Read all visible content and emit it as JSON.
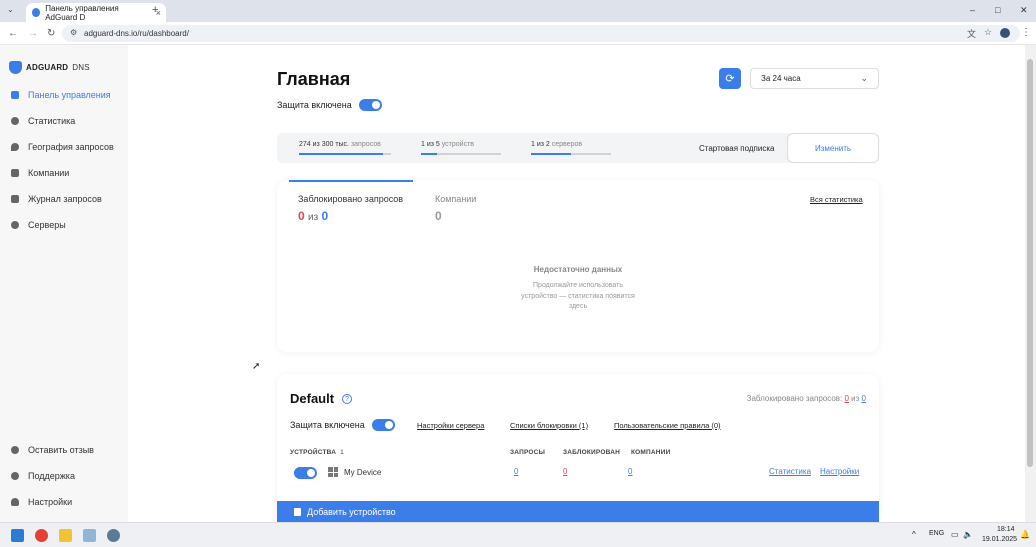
{
  "browser": {
    "tab_title": "Панель управления AdGuard D",
    "tab_close": "×",
    "new_tab": "+",
    "url": "adguard-dns.io/ru/dashboard/",
    "back": "←",
    "forward": "→",
    "reload": "↻",
    "minimize": "–",
    "maximize": "□",
    "close": "✕"
  },
  "sidebar": {
    "logo_brand": "ADGUARD",
    "logo_suffix": "DNS",
    "items": [
      {
        "label": "Панель управления",
        "icon": "home-icon",
        "active": true
      },
      {
        "label": "Статистика",
        "icon": "chart-icon"
      },
      {
        "label": "География запросов",
        "icon": "location-icon"
      },
      {
        "label": "Компании",
        "icon": "company-icon"
      },
      {
        "label": "Журнал запросов",
        "icon": "folder-icon"
      },
      {
        "label": "Серверы",
        "icon": "server-icon"
      }
    ],
    "bottom_items": [
      {
        "label": "Оставить отзыв",
        "icon": "chat-icon"
      },
      {
        "label": "Поддержка",
        "icon": "support-icon"
      },
      {
        "label": "Настройки",
        "icon": "user-icon"
      }
    ]
  },
  "header": {
    "title": "Главная",
    "protection_label": "Защита включена",
    "period": "За 24 часа"
  },
  "limits": {
    "requests_value": "274 из 300 тыс.",
    "requests_unit": "запросов",
    "requests_fill": 0.91,
    "devices_value": "1 из 5",
    "devices_unit": "устройств",
    "devices_fill": 0.2,
    "servers_value": "1 из 2",
    "servers_unit": "серверов",
    "servers_fill": 0.5,
    "plan": "Стартовая подписка",
    "change": "Изменить"
  },
  "stats_card": {
    "tab_blocked": "Заблокировано запросов",
    "blocked_num": "0",
    "of": "из",
    "total_num": "0",
    "tab_companies": "Компании",
    "companies_num": "0",
    "all_stats": "Вся статистика",
    "empty_title": "Недостаточно данных",
    "empty_text": "Продолжайте использовать устройство — статистика появится здесь"
  },
  "server_card": {
    "name": "Default",
    "help": "?",
    "blocked_label": "Заблокировано запросов:",
    "blocked_num": "0",
    "of": "из",
    "total_num": "0",
    "protection_label": "Защита включена",
    "server_settings": "Настройки сервера",
    "blocklists": "Списки блокировки (1)",
    "user_rules": "Пользовательские правила (0)",
    "col_devices": "УСТРОЙСТВА",
    "devices_count": "1",
    "col_requests": "ЗАПРОСЫ",
    "col_blocked": "ЗАБЛОКИРОВАН",
    "col_companies": "КОМПАНИИ",
    "device": {
      "name": "My Device",
      "requests": "0",
      "blocked": "0",
      "companies": "0",
      "stats_link": "Статистика",
      "settings_link": "Настройки"
    },
    "add_device": "Добавить устройство"
  },
  "taskbar": {
    "lang": "ENG",
    "time": "18:14",
    "date": "19.01.2025"
  },
  "colors": {
    "accent": "#3b7de9",
    "danger": "#e5484d"
  }
}
